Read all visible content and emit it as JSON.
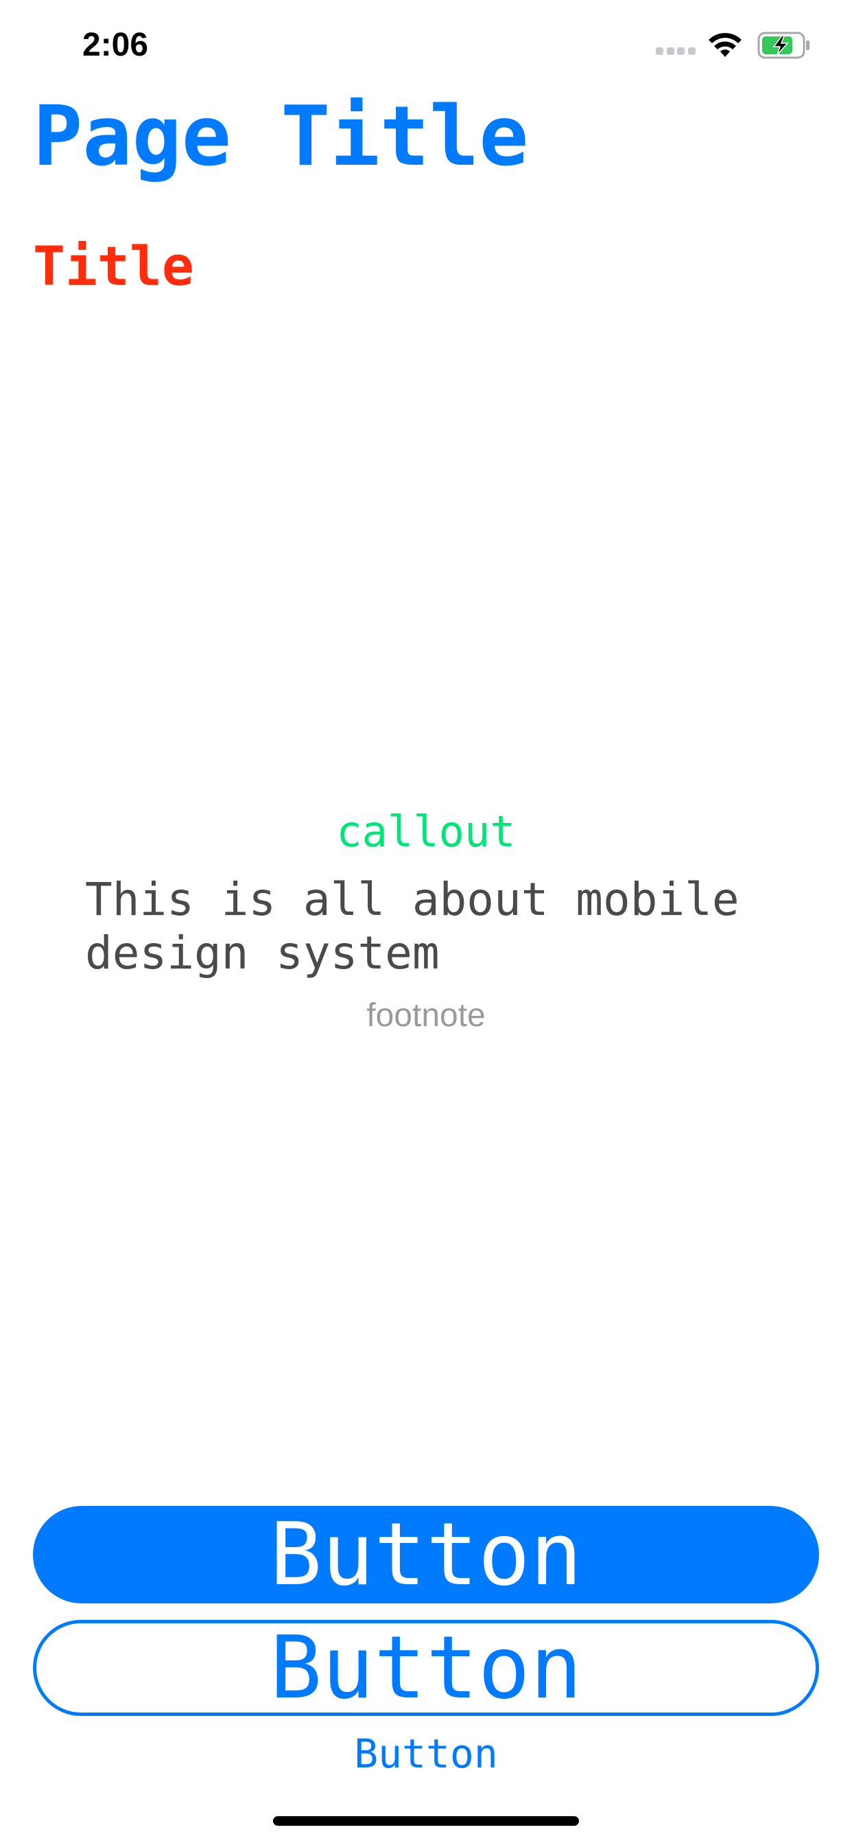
{
  "status_bar": {
    "time": "2:06",
    "icons": [
      "signal-icon",
      "wifi-icon",
      "battery-charging-icon"
    ],
    "battery_color": "#34c759"
  },
  "page_title": "Page Title",
  "section_title": "Title",
  "callout": "callout",
  "body_text": "This is all about mobile design system",
  "footnote": "footnote",
  "buttons": {
    "filled_label": "Button",
    "outline_label": "Button",
    "text_label": "Button"
  },
  "colors": {
    "accent": "#007aff",
    "title": "#ff2d0b",
    "callout": "#00e676",
    "body": "#4a4a4a",
    "footnote": "#9a9a9a"
  }
}
